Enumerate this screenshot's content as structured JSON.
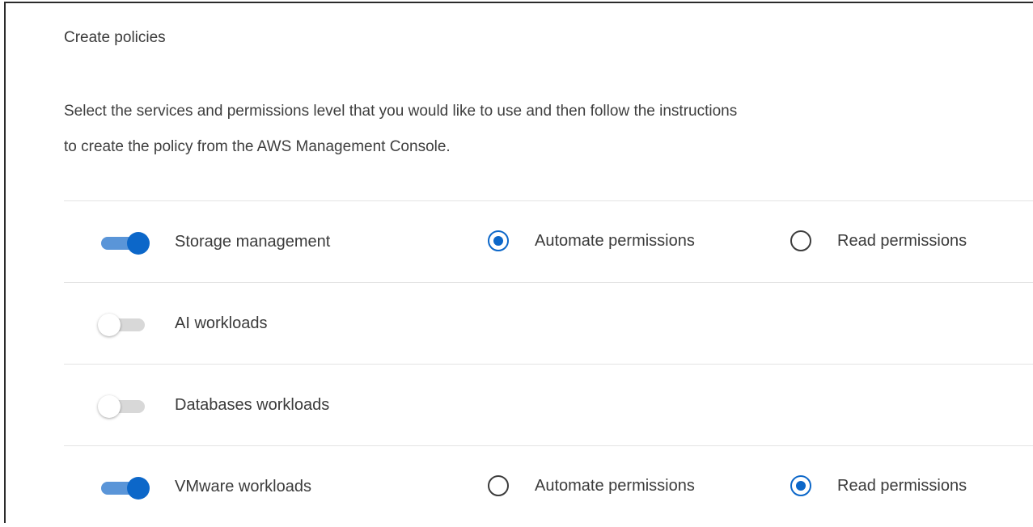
{
  "panel": {
    "title": "Create policies",
    "description_line1": "Select the services and permissions level that you would like to use and then follow the instructions",
    "description_line2": "to create the policy from the AWS Management Console."
  },
  "services": [
    {
      "label": "Storage management",
      "enabled": true,
      "options": [
        {
          "label": "Automate permissions",
          "selected": true
        },
        {
          "label": "Read permissions",
          "selected": false
        }
      ]
    },
    {
      "label": "AI workloads",
      "enabled": false,
      "options": []
    },
    {
      "label": "Databases workloads",
      "enabled": false,
      "options": []
    },
    {
      "label": "VMware workloads",
      "enabled": true,
      "options": [
        {
          "label": "Automate permissions",
          "selected": false
        },
        {
          "label": "Read permissions",
          "selected": true
        }
      ]
    }
  ],
  "colors": {
    "accent": "#0c67c9",
    "accent_track": "#5a95d8",
    "toggle_off_track": "#d8d8d8",
    "divider": "#e4e4e4"
  }
}
